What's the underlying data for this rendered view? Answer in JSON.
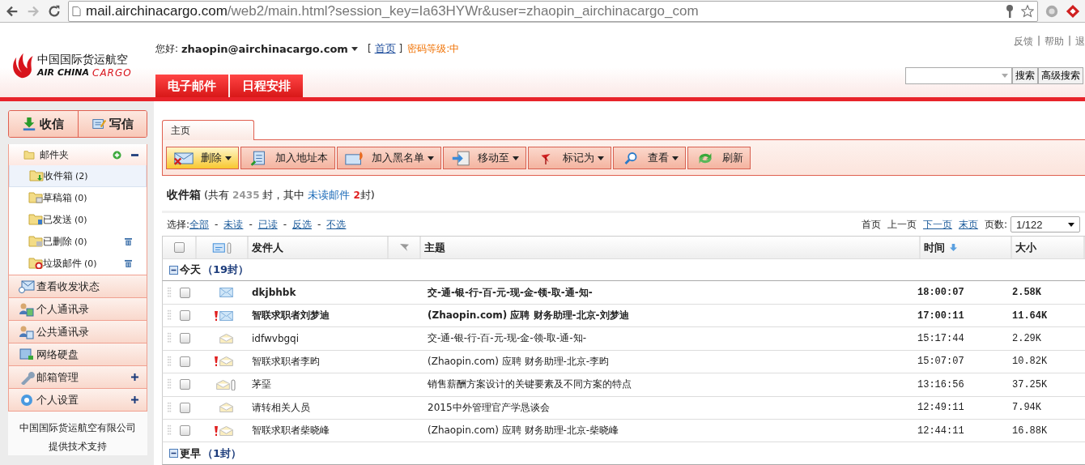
{
  "browser": {
    "url_host": "mail.airchinacargo.com",
    "url_path": "/web2/main.html?session_key=Ia63HYWr&user=zhaopin_airchinacargo_com"
  },
  "header": {
    "logo_cn": "中国国际货运航空",
    "logo_en_1": "AIR CHINA",
    "logo_en_2": "CARGO",
    "greeting": "您好:",
    "user": "zhaopin@airchinacargo.com",
    "bracket_open": "[",
    "home_link": "首页",
    "bracket_close": "]",
    "password_level": "密码等级:中",
    "top_links": [
      "反馈",
      "帮助",
      "退"
    ],
    "top_link_separator": "|",
    "tabs": [
      {
        "label": "电子邮件"
      },
      {
        "label": "日程安排"
      }
    ],
    "search_button": "搜索",
    "advanced_search_button": "高级搜索"
  },
  "sidebar": {
    "actions": [
      {
        "label": "收信",
        "kind": "receive"
      },
      {
        "label": "写信",
        "kind": "compose"
      }
    ],
    "folder_header": "邮件夹",
    "folders": [
      {
        "name": "收件箱",
        "count": "(2)",
        "selected": true,
        "kind": "inbox",
        "trash": false
      },
      {
        "name": "草稿箱",
        "count": "(0)",
        "selected": false,
        "kind": "drafts",
        "trash": false
      },
      {
        "name": "已发送",
        "count": "(0)",
        "selected": false,
        "kind": "sent",
        "trash": false
      },
      {
        "name": "已删除",
        "count": "(0)",
        "selected": false,
        "kind": "deleted",
        "trash": true
      },
      {
        "name": "垃圾邮件",
        "count": "(0)",
        "selected": false,
        "kind": "spam",
        "trash": true
      }
    ],
    "nav": [
      {
        "label": "查看收发状态",
        "kind": "status",
        "expandable": false
      },
      {
        "label": "个人通讯录",
        "kind": "contacts",
        "expandable": false
      },
      {
        "label": "公共通讯录",
        "kind": "public",
        "expandable": false
      },
      {
        "label": "网络硬盘",
        "kind": "disk",
        "expandable": false
      },
      {
        "label": "邮箱管理",
        "kind": "admin",
        "expandable": true
      },
      {
        "label": "个人设置",
        "kind": "settings",
        "expandable": true
      }
    ],
    "footer": [
      "中国国际货运航空有限公司",
      "提供技术支持"
    ]
  },
  "main": {
    "tab": "主页",
    "toolbar": [
      {
        "label": "删除",
        "kind": "delete",
        "dropdown": true,
        "selected": true
      },
      {
        "label": "加入地址本",
        "kind": "addressbook",
        "dropdown": false,
        "selected": false
      },
      {
        "label": "加入黑名单",
        "kind": "blacklist",
        "dropdown": true,
        "selected": false
      },
      {
        "label": "移动至",
        "kind": "move",
        "dropdown": true,
        "selected": false
      },
      {
        "label": "标记为",
        "kind": "mark",
        "dropdown": true,
        "selected": false
      },
      {
        "label": "查看",
        "kind": "view",
        "dropdown": true,
        "selected": false
      },
      {
        "label": "刷新",
        "kind": "refresh",
        "dropdown": false,
        "selected": false
      }
    ],
    "summary": {
      "title": "收件箱",
      "pre": "(共有",
      "total": "2435",
      "mid": "封，其中",
      "unread_link": "未读邮件",
      "unread_count": "2",
      "post": "封)"
    },
    "select": {
      "label": "选择:",
      "separator": "-",
      "links": [
        "全部",
        "未读",
        "已读",
        "反选",
        "不选"
      ]
    },
    "pager": {
      "items": [
        {
          "label": "首页",
          "link": false
        },
        {
          "label": "上一页",
          "link": false
        },
        {
          "label": "下一页",
          "link": true
        },
        {
          "label": "末页",
          "link": true
        }
      ],
      "page_label": "页数:",
      "page_value": "1/122"
    },
    "select_all_checked": false,
    "columns": [
      "发件人",
      "主题",
      "时间",
      "大小"
    ],
    "groups": [
      {
        "label": "今天",
        "count": "（19封）",
        "expanded": true,
        "rows": [
          {
            "sender": "dkjbhbk",
            "subject": "交-通-银-行-百-元-现-金-领-取-通-知-",
            "time": "18:00:07",
            "size": "2.58K",
            "unread": true,
            "important": false,
            "attachment": false,
            "checked": false
          },
          {
            "sender": "智联求职者刘梦迪",
            "subject": "(Zhaopin.com) 应聘 财务助理-北京-刘梦迪",
            "time": "17:00:11",
            "size": "11.64K",
            "unread": true,
            "important": true,
            "attachment": false,
            "checked": false
          },
          {
            "sender": "idfwvbgqi",
            "subject": "交-通-银-行-百-元-现-金-领-取-通-知-",
            "time": "15:17:44",
            "size": "2.29K",
            "unread": false,
            "important": false,
            "attachment": false,
            "checked": false
          },
          {
            "sender": "智联求职者李昀",
            "subject": "(Zhaopin.com) 应聘 财务助理-北京-李昀",
            "time": "15:07:07",
            "size": "10.82K",
            "unread": false,
            "important": true,
            "attachment": false,
            "checked": false
          },
          {
            "sender": "茅堊",
            "subject": "销售薪酬方案设计的关键要素及不同方案的特点",
            "time": "13:16:56",
            "size": "37.25K",
            "unread": false,
            "important": false,
            "attachment": true,
            "checked": false
          },
          {
            "sender": "请转相关人员",
            "subject": "2015中外管理官产学恳谈会",
            "time": "12:49:11",
            "size": "7.94K",
            "unread": false,
            "important": false,
            "attachment": false,
            "checked": false
          },
          {
            "sender": "智联求职者柴晓峰",
            "subject": "(Zhaopin.com) 应聘 财务助理-北京-柴晓峰",
            "time": "12:44:11",
            "size": "16.88K",
            "unread": false,
            "important": true,
            "attachment": false,
            "checked": false
          }
        ]
      },
      {
        "label": "更早",
        "count": "（1封）",
        "expanded": true
      }
    ]
  }
}
